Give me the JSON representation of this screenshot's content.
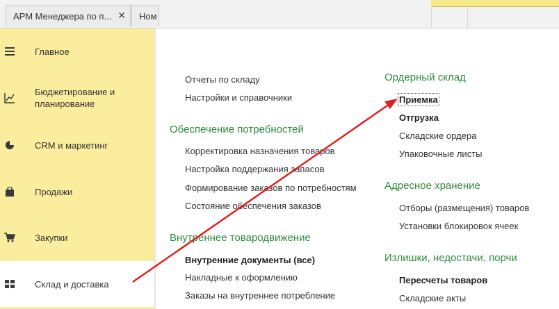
{
  "tabs": [
    {
      "label": "АРМ Менеджера по п...",
      "close": "✕"
    },
    {
      "label": "Ном"
    }
  ],
  "sidebar": {
    "items": [
      {
        "label": "Главное",
        "icon": "menu-lines-icon"
      },
      {
        "label": "Бюджетирование и\nпланирование",
        "icon": "budget-chart-icon"
      },
      {
        "label": "CRM и маркетинг",
        "icon": "pie-chart-icon"
      },
      {
        "label": "Продажи",
        "icon": "shopping-bag-icon"
      },
      {
        "label": "Закупки",
        "icon": "cart-icon"
      },
      {
        "label": "Склад и доставка",
        "icon": "grid-icon"
      }
    ]
  },
  "content": {
    "col1": {
      "top_links": [
        "Отчеты по складу",
        "Настройки и справочники"
      ],
      "group1": {
        "title": "Обеспечение потребностей",
        "links": [
          "Корректировка назначения товаров",
          "Настройка поддержания запасов",
          "Формирование заказов по потребностям",
          "Состояние обеспечения заказов"
        ]
      },
      "group2": {
        "title": "Внутреннее товародвижение",
        "links": [
          "Внутренние документы (все)",
          "Накладные к оформлению",
          "Заказы на внутреннее потребление"
        ]
      }
    },
    "col2": {
      "group1": {
        "title": "Ордерный склад",
        "links": [
          "Приемка",
          "Отгрузка",
          "Складские ордера",
          "Упаковочные листы"
        ]
      },
      "group2": {
        "title": "Адресное хранение",
        "links": [
          "Отборы (размещения) товаров",
          "Установки блокировок ячеек"
        ]
      },
      "group3": {
        "title": "Излишки, недостачи, порчи",
        "links": [
          "Пересчеты товаров",
          "Складские акты"
        ]
      }
    }
  },
  "colors": {
    "sidebar_bg": "#fbed9e",
    "group_title": "#2e8b3c",
    "arrow": "#e02020"
  }
}
